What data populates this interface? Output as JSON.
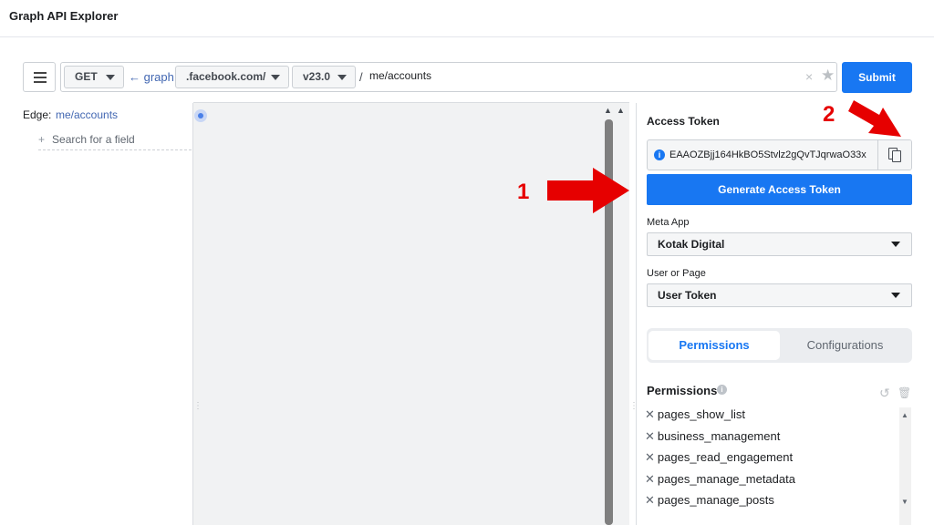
{
  "app": {
    "title": "Graph API Explorer"
  },
  "request": {
    "method": "GET",
    "graph_prefix": "← graph.",
    "host": ".facebook.com/",
    "version": "v23.0",
    "slash": "/",
    "path": "me/accounts",
    "clear_icon": "×",
    "star_icon": "★",
    "submit_label": "Submit"
  },
  "explorer": {
    "edge_label": "Edge:",
    "edge_value": "me/accounts",
    "search_plus": "+",
    "search_placeholder": "Search for a field"
  },
  "panel": {
    "access_token_title": "Access Token",
    "token_value": "EAAOZBjj164HkBO5Stvlz2gQvTJqrwaO33x",
    "info_icon": "i",
    "generate_label": "Generate Access Token",
    "meta_app_label": "Meta App",
    "meta_app_value": "Kotak Digital",
    "user_page_label": "User or Page",
    "user_page_value": "User Token",
    "tabs": [
      {
        "label": "Permissions",
        "active": true
      },
      {
        "label": "Configurations",
        "active": false
      }
    ],
    "permissions_title": "Permissions",
    "permissions": [
      "pages_show_list",
      "business_management",
      "pages_read_engagement",
      "pages_manage_metadata",
      "pages_manage_posts"
    ]
  },
  "annotations": {
    "step1": "1",
    "step2": "2",
    "arrow_color": "#e60000"
  },
  "colors": {
    "accent": "#1877f2",
    "link": "#4267b2"
  }
}
